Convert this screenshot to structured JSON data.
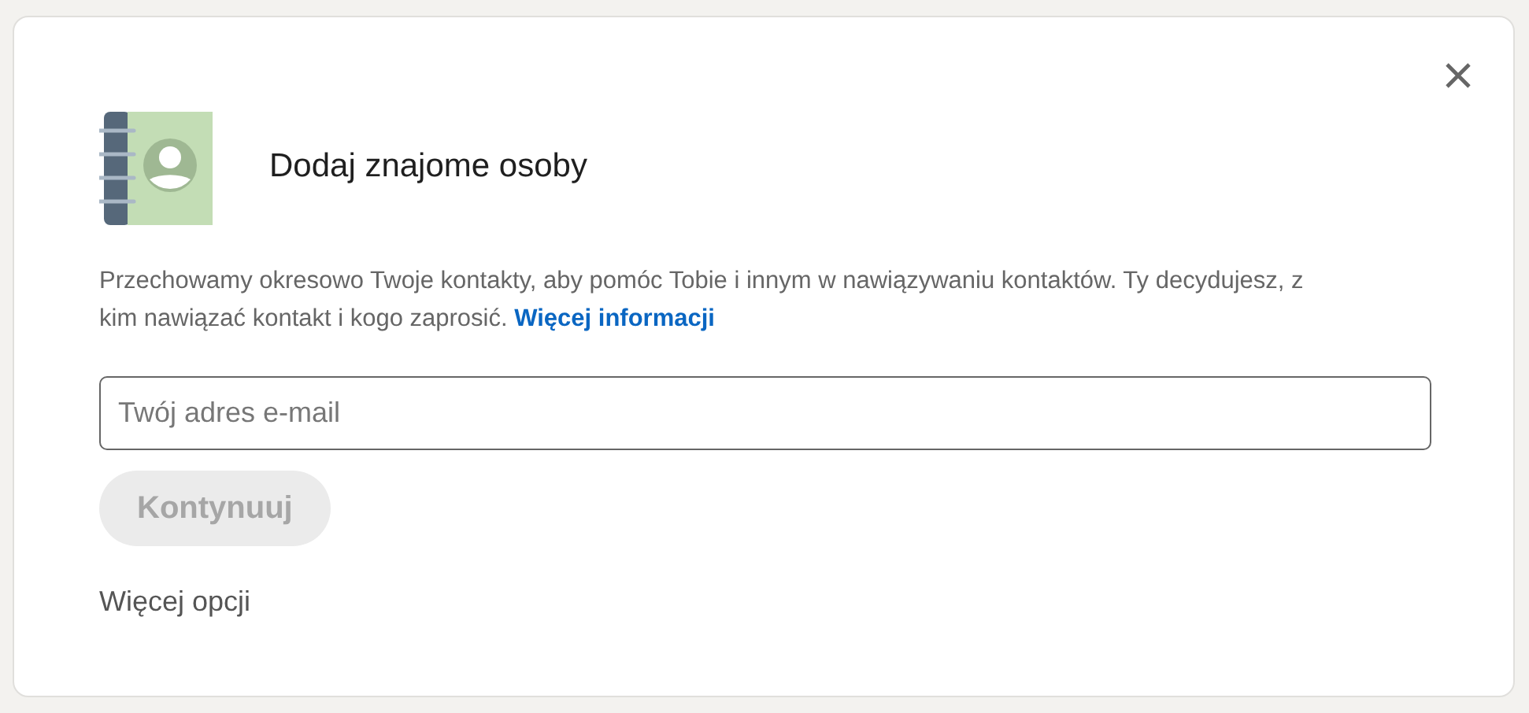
{
  "dialog": {
    "title": "Dodaj znajome osoby",
    "description": {
      "text": "Przechowamy okresowo Twoje kontakty, aby pomóc Tobie i innym w nawiązywaniu kontaktów. Ty decydujesz, z kim nawiązać kontakt i kogo zaprosić.",
      "link": "Więcej informacji"
    },
    "email_field": {
      "placeholder": "Twój adres e-mail"
    },
    "continue_button": {
      "label": "Kontynuuj",
      "disabled": true
    },
    "more_options": "Więcej opcji"
  }
}
